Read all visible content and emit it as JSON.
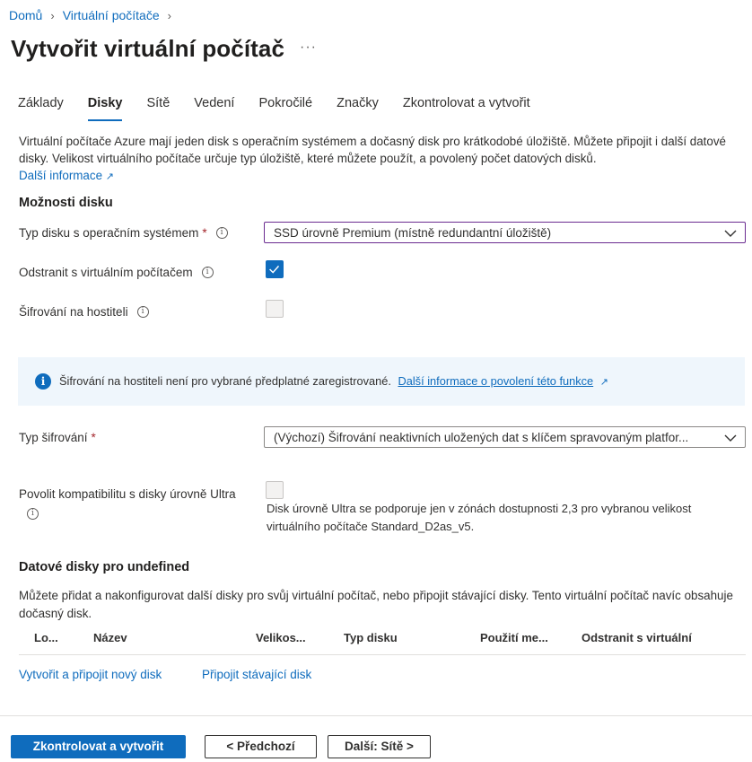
{
  "breadcrumb": {
    "home": "Domů",
    "vms": "Virtuální počítače"
  },
  "page": {
    "title": "Vytvořit virtuální počítač",
    "more": "···"
  },
  "tabs": [
    {
      "label": "Základy"
    },
    {
      "label": "Disky",
      "active": true
    },
    {
      "label": "Sítě"
    },
    {
      "label": "Vedení"
    },
    {
      "label": "Pokročilé"
    },
    {
      "label": "Značky"
    },
    {
      "label": "Zkontrolovat a vytvořit"
    }
  ],
  "intro": {
    "text": "Virtuální počítače Azure mají jeden disk s operačním systémem a dočasný disk pro krátkodobé úložiště. Můžete připojit i další datové disky. Velikost virtuálního počítače určuje typ úložiště, které můžete použít, a povolený počet datových disků.",
    "link": "Další informace"
  },
  "disk_options": {
    "heading": "Možnosti disku",
    "os_disk_type": {
      "label": "Typ disku s operačním systémem",
      "value": "SSD úrovně Premium (místně redundantní úložiště)"
    },
    "delete_with_vm": {
      "label": "Odstranit s virtuálním počítačem",
      "checked": true
    },
    "host_encryption": {
      "label": "Šifrování na hostiteli",
      "checked": false
    }
  },
  "banner": {
    "text": "Šifrování na hostiteli není pro vybrané předplatné zaregistrované.",
    "link": "Další informace o povolení této funkce"
  },
  "encryption_type": {
    "label": "Typ šifrování",
    "value": "(Výchozí) Šifrování neaktivních uložených dat s klíčem spravovaným platfor..."
  },
  "ultra": {
    "label": "Povolit kompatibilitu s disky úrovně Ultra",
    "checked": false,
    "note_line1": "Disk úrovně Ultra se podporuje jen v zónách dostupnosti 2,3 pro vybranou velikost",
    "note_line2": "virtuálního počítače Standard_D2as_v5."
  },
  "data_disks": {
    "heading": "Datové disky pro undefined",
    "text": "Můžete přidat a nakonfigurovat další disky pro svůj virtuální počítač, nebo připojit stávající disky. Tento virtuální počítač navíc obsahuje dočasný disk.",
    "columns": [
      "Lo...",
      "Název",
      "Velikos...",
      "Typ disku",
      "Použití me...",
      "Odstranit s virtuální"
    ],
    "create_link": "Vytvořit a připojit nový disk",
    "attach_link": "Připojit stávající disk"
  },
  "footer": {
    "review": "Zkontrolovat a vytvořit",
    "prev": "< Předchozí",
    "next": "Další: Sítě >"
  },
  "colors": {
    "accent": "#0f6cbd",
    "required": "#a4262c",
    "banner_bg": "#eff6fc"
  }
}
